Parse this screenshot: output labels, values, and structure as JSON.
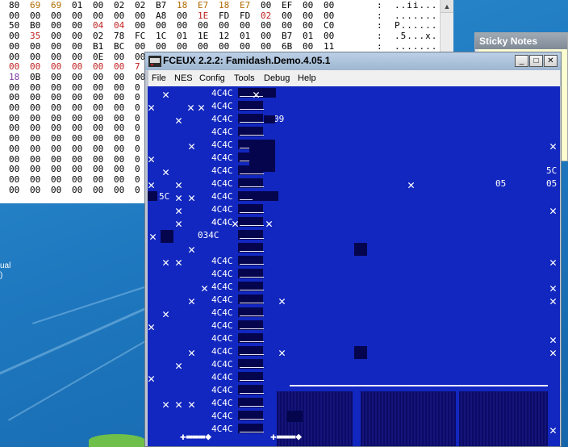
{
  "colors": {
    "desktop": "#1f79c0",
    "emulator_bg": "#1227bf",
    "dark_tile": "#05054e"
  },
  "hex_editor": {
    "rows": [
      {
        "bytes": [
          "80",
          "69",
          "69",
          "01",
          "00",
          "02",
          "02",
          "B7",
          "18",
          "E7",
          "18",
          "E7",
          "00",
          "EF",
          "00",
          "00"
        ],
        "ascii": ". . i i . . . . . . . . . . . ."
      },
      {
        "bytes": [
          "00",
          "00",
          "00",
          "00",
          "00",
          "00",
          "00",
          "A8",
          "00",
          "1E",
          "FD",
          "FD",
          "02",
          "00",
          "00",
          "00"
        ],
        "ascii": ". . . . . . . . . . . . . . . ."
      },
      {
        "bytes": [
          "50",
          "B0",
          "00",
          "00",
          "04",
          "04",
          "00",
          "00",
          "00",
          "00",
          "00",
          "00",
          "00",
          "00",
          "00",
          "C0"
        ],
        "ascii": "P . . . . . . . . . . . . . . ."
      },
      {
        "bytes": [
          "00",
          "35",
          "00",
          "00",
          "02",
          "78",
          "FC",
          "1C",
          "01",
          "1E",
          "12",
          "01",
          "00",
          "B7",
          "01",
          "00"
        ],
        "ascii": ". 5 . . . x . . . . . . . . . ."
      },
      {
        "bytes": [
          "00",
          "00",
          "00",
          "00",
          "B1",
          "BC",
          "00",
          "00",
          "00",
          "00",
          "00",
          "00",
          "00",
          "6B",
          "00",
          "11"
        ],
        "ascii": ". . . . . . . . . . . . . . . ."
      },
      {
        "bytes": [
          "00",
          "00",
          "00",
          "00",
          "0E",
          "00",
          "00",
          "",
          "",
          "",
          "",
          "",
          "",
          "",
          "",
          ""
        ],
        "ascii": ""
      },
      {
        "bytes": [
          "00",
          "00",
          "00",
          "00",
          "00",
          "00",
          "7",
          "",
          "",
          "",
          "",
          "",
          "",
          "",
          "",
          ""
        ],
        "ascii": ""
      },
      {
        "bytes": [
          "18",
          "0B",
          "00",
          "00",
          "00",
          "00",
          "00",
          "",
          "",
          "",
          "",
          "",
          "",
          "",
          "",
          ""
        ],
        "ascii": ""
      },
      {
        "bytes": [
          "00",
          "00",
          "00",
          "00",
          "00",
          "00",
          "0",
          "",
          "",
          "",
          "",
          "",
          "",
          "",
          "",
          ""
        ],
        "ascii": ""
      },
      {
        "bytes": [
          "00",
          "00",
          "00",
          "00",
          "00",
          "00",
          "0",
          "",
          "",
          "",
          "",
          "",
          "",
          "",
          "",
          ""
        ],
        "ascii": ""
      },
      {
        "bytes": [
          "00",
          "00",
          "00",
          "00",
          "00",
          "00",
          "0",
          "",
          "",
          "",
          "",
          "",
          "",
          "",
          "",
          ""
        ],
        "ascii": ""
      },
      {
        "bytes": [
          "00",
          "00",
          "00",
          "00",
          "00",
          "00",
          "0",
          "",
          "",
          "",
          "",
          "",
          "",
          "",
          "",
          ""
        ],
        "ascii": ""
      },
      {
        "bytes": [
          "00",
          "00",
          "00",
          "00",
          "00",
          "00",
          "0",
          "",
          "",
          "",
          "",
          "",
          "",
          "",
          "",
          ""
        ],
        "ascii": ""
      },
      {
        "bytes": [
          "00",
          "00",
          "00",
          "00",
          "00",
          "00",
          "0",
          "",
          "",
          "",
          "",
          "",
          "",
          "",
          "",
          ""
        ],
        "ascii": ""
      },
      {
        "bytes": [
          "00",
          "00",
          "00",
          "00",
          "00",
          "00",
          "0",
          "",
          "",
          "",
          "",
          "",
          "",
          "",
          "",
          ""
        ],
        "ascii": ""
      },
      {
        "bytes": [
          "00",
          "00",
          "00",
          "00",
          "00",
          "00",
          "0",
          "",
          "",
          "",
          "",
          "",
          "",
          "",
          "",
          ""
        ],
        "ascii": ""
      },
      {
        "bytes": [
          "00",
          "00",
          "00",
          "00",
          "00",
          "00",
          "0",
          "",
          "",
          "",
          "",
          "",
          "",
          "",
          "",
          ""
        ],
        "ascii": ""
      },
      {
        "bytes": [
          "00",
          "00",
          "00",
          "00",
          "00",
          "00",
          "0",
          "",
          "",
          "",
          "",
          "",
          "",
          "",
          "",
          ""
        ],
        "ascii": ""
      },
      {
        "bytes": [
          "00",
          "00",
          "00",
          "00",
          "00",
          "00",
          "0",
          "",
          "",
          "",
          "",
          "",
          "",
          "",
          "",
          ""
        ],
        "ascii": ""
      }
    ],
    "byte_colors": [
      [
        "#000",
        "#b06a00",
        "#b06a00",
        "#000",
        "#000",
        "#000",
        "#000",
        "#000",
        "#b06a00",
        "#b06a00",
        "#b06a00",
        "#b06a00",
        "#000",
        "#000",
        "#000",
        "#000"
      ],
      [
        "#000",
        "#000",
        "#000",
        "#000",
        "#000",
        "#000",
        "#000",
        "#000",
        "#000",
        "#c02020",
        "#000",
        "#000",
        "#c02020",
        "#000",
        "#000",
        "#000"
      ],
      [
        "#000",
        "#000",
        "#000",
        "#000",
        "#c02020",
        "#c02020",
        "#000",
        "#000",
        "#000",
        "#000",
        "#000",
        "#000",
        "#000",
        "#000",
        "#000",
        "#000"
      ],
      [
        "#000",
        "#c02020",
        "#000",
        "#000",
        "#000",
        "#000",
        "#000",
        "#000",
        "#000",
        "#000",
        "#000",
        "#000",
        "#000",
        "#000",
        "#000",
        "#000"
      ],
      [],
      [],
      [
        "#c02020",
        "#c02020",
        "#c02020",
        "#c02020",
        "#c02020",
        "#c02020",
        "#c02020"
      ],
      [
        "#7a3aa0",
        "#000"
      ]
    ]
  },
  "desktop": {
    "partial_text": [
      "ual",
      ")",
      "",
      "",
      "",
      "i"
    ]
  },
  "sticky_notes": {
    "title": "Sticky Notes"
  },
  "fceux": {
    "title": "FCEUX 2.2.2: Famidash.Demo.4.05.1",
    "menu": [
      "File",
      "NES",
      "Config",
      "Tools",
      "Debug",
      "Help"
    ],
    "window_buttons": {
      "minimize": "_",
      "maximize": "□",
      "close": "✕"
    },
    "screen_labels": [
      "4C4C",
      "09",
      "05",
      "05",
      "5C",
      "5C",
      "4C",
      "034C"
    ]
  }
}
